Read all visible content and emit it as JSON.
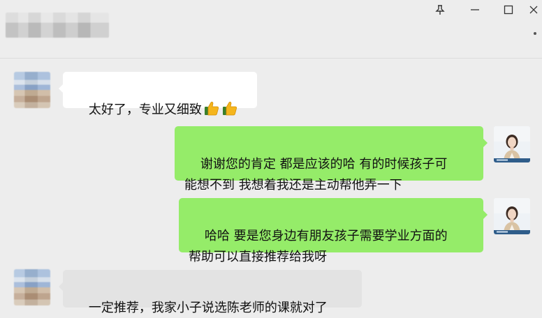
{
  "window": {
    "pin_icon": "pin-icon",
    "minimize_icon": "minimize-icon",
    "maximize_icon": "maximize-icon",
    "close_icon": "close-icon",
    "more_icon": "more-icon"
  },
  "messages": [
    {
      "side": "in",
      "text": "太好了，专业又细致",
      "emoji": [
        "thumbs-up-icon",
        "thumbs-up-icon"
      ]
    },
    {
      "side": "out",
      "text": "谢谢您的肯定 都是应该的哈 有的时候孩子可\n能想不到 我想着我还是主动帮他弄一下"
    },
    {
      "side": "out",
      "text": "哈哈 要是您身边有朋友孩子需要学业方面的\n帮助可以直接推荐给我呀"
    },
    {
      "side": "in",
      "text": "一定推荐，我家小子说选陈老师的课就对了"
    }
  ],
  "colors": {
    "background": "#ededed",
    "incoming_bubble": "#ffffff",
    "outgoing_bubble": "#95ec69"
  }
}
